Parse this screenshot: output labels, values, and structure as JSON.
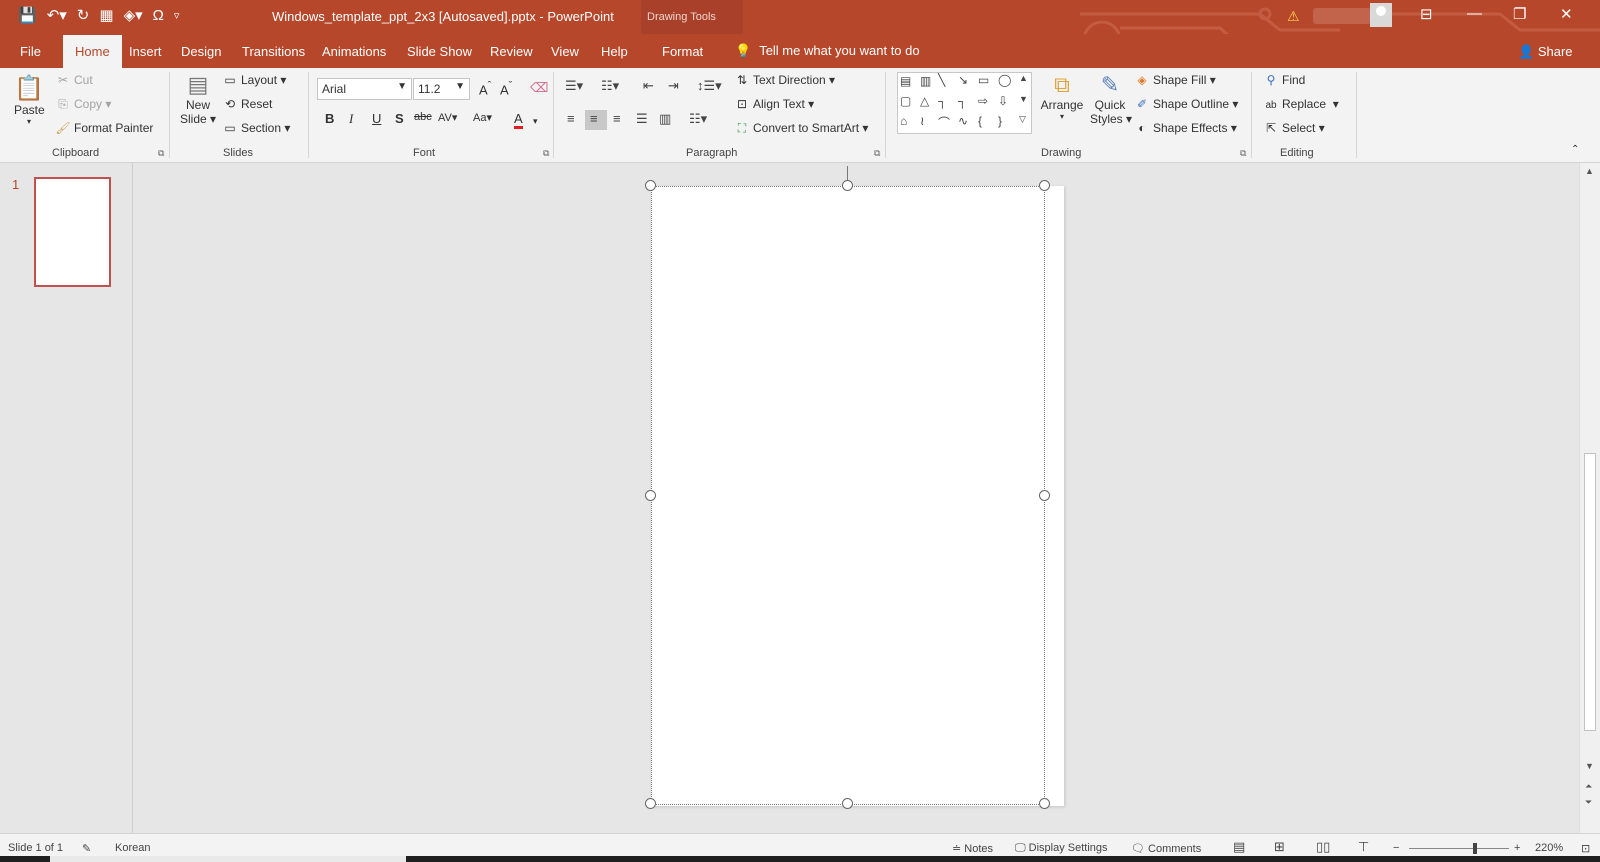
{
  "title": {
    "document": "Windows_template_ppt_2x3 [Autosaved].pptx  -  PowerPoint",
    "context_label": "Drawing Tools"
  },
  "qat": [
    "save-icon",
    "undo-icon",
    "redo-icon",
    "presentation-icon",
    "paint-icon",
    "omega-icon",
    "customize-icon"
  ],
  "tabs": {
    "file": "File",
    "home": "Home",
    "insert": "Insert",
    "design": "Design",
    "transitions": "Transitions",
    "animations": "Animations",
    "slideshow": "Slide Show",
    "review": "Review",
    "view": "View",
    "help": "Help",
    "format": "Format"
  },
  "tellme": "Tell me what you want to do",
  "share": "Share",
  "ribbon": {
    "clipboard": {
      "label": "Clipboard",
      "paste": "Paste",
      "cut": "Cut",
      "copy": "Copy",
      "format_painter": "Format Painter"
    },
    "slides": {
      "label": "Slides",
      "new_slide_1": "New",
      "new_slide_2": "Slide",
      "layout": "Layout",
      "reset": "Reset",
      "section": "Section"
    },
    "font": {
      "label": "Font",
      "font_name": "Arial",
      "font_size": "11.2"
    },
    "paragraph": {
      "label": "Paragraph",
      "text_direction": "Text Direction",
      "align_text": "Align Text",
      "convert_smartart": "Convert to SmartArt"
    },
    "drawing": {
      "label": "Drawing",
      "arrange": "Arrange",
      "quick_styles_1": "Quick",
      "quick_styles_2": "Styles",
      "shape_fill": "Shape Fill",
      "shape_outline": "Shape Outline",
      "shape_effects": "Shape Effects"
    },
    "editing": {
      "label": "Editing",
      "find": "Find",
      "replace": "Replace",
      "select": "Select"
    }
  },
  "slides_pane": {
    "number": "1"
  },
  "status": {
    "slide": "Slide 1 of 1",
    "language": "Korean",
    "notes": "Notes",
    "display_settings": "Display Settings",
    "comments": "Comments",
    "zoom": "220%"
  },
  "colors": {
    "accent": "#b7472a",
    "ribbon": "#f3f3f3",
    "canvas": "#e6e6e6"
  }
}
